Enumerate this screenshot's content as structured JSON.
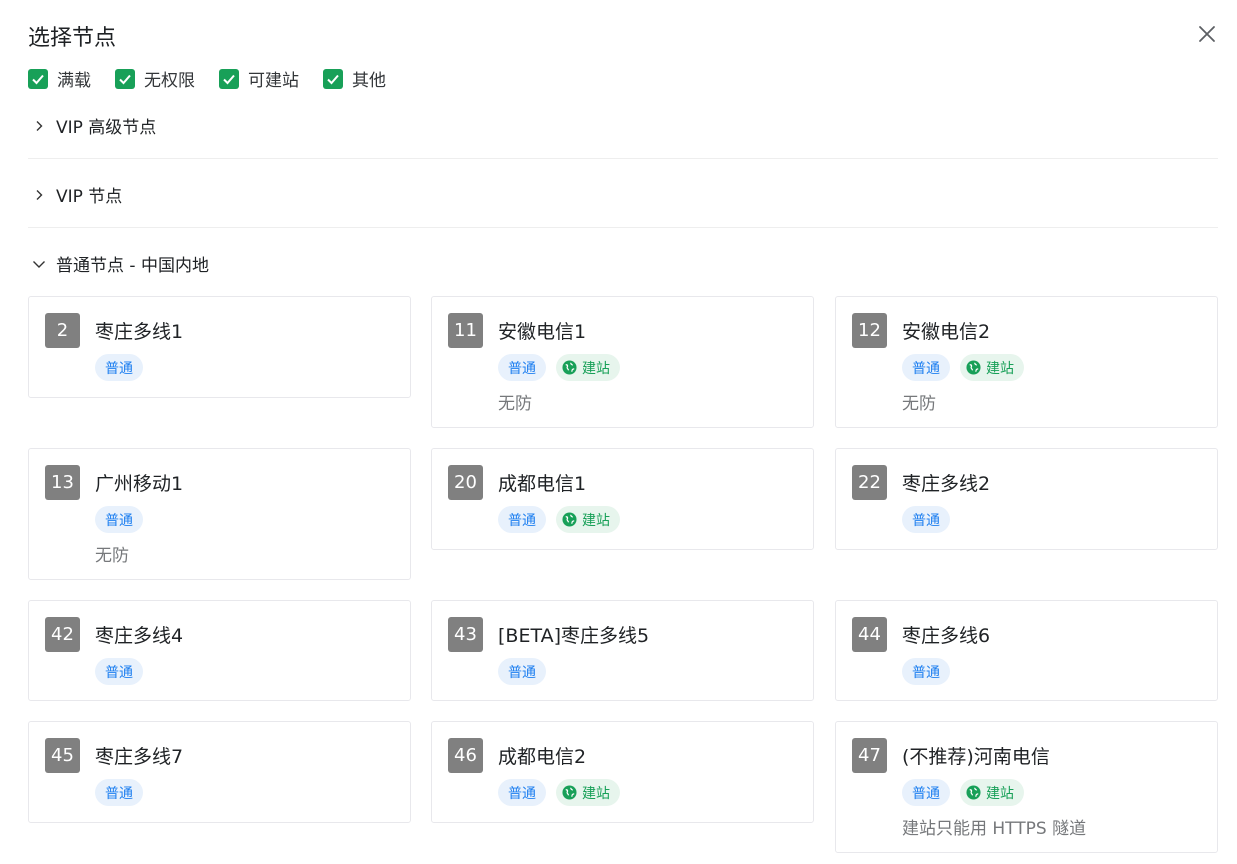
{
  "dialog": {
    "title": "选择节点",
    "close_icon": "close-icon"
  },
  "filters": [
    {
      "label": "满载",
      "checked": true
    },
    {
      "label": "无权限",
      "checked": true
    },
    {
      "label": "可建站",
      "checked": true
    },
    {
      "label": "其他",
      "checked": true
    }
  ],
  "groups": [
    {
      "label": "VIP 高级节点",
      "expanded": false
    },
    {
      "label": "VIP 节点",
      "expanded": false
    },
    {
      "label": "普通节点 - 中国内地",
      "expanded": true
    }
  ],
  "tag_labels": {
    "normal": "普通",
    "site": "建站"
  },
  "colors": {
    "accent_green": "#18a058",
    "tag_blue": "#2080f0",
    "badge_gray": "#808080"
  },
  "nodes": [
    {
      "id": "2",
      "name": "枣庄多线1",
      "tags": [
        "普通"
      ],
      "site": false,
      "note": ""
    },
    {
      "id": "11",
      "name": "安徽电信1",
      "tags": [
        "普通"
      ],
      "site": true,
      "note": "无防"
    },
    {
      "id": "12",
      "name": "安徽电信2",
      "tags": [
        "普通"
      ],
      "site": true,
      "note": "无防"
    },
    {
      "id": "13",
      "name": "广州移动1",
      "tags": [
        "普通"
      ],
      "site": false,
      "note": "无防"
    },
    {
      "id": "20",
      "name": "成都电信1",
      "tags": [
        "普通"
      ],
      "site": true,
      "note": ""
    },
    {
      "id": "22",
      "name": "枣庄多线2",
      "tags": [
        "普通"
      ],
      "site": false,
      "note": ""
    },
    {
      "id": "42",
      "name": "枣庄多线4",
      "tags": [
        "普通"
      ],
      "site": false,
      "note": ""
    },
    {
      "id": "43",
      "name": "[BETA]枣庄多线5",
      "tags": [
        "普通"
      ],
      "site": false,
      "note": ""
    },
    {
      "id": "44",
      "name": "枣庄多线6",
      "tags": [
        "普通"
      ],
      "site": false,
      "note": ""
    },
    {
      "id": "45",
      "name": "枣庄多线7",
      "tags": [
        "普通"
      ],
      "site": false,
      "note": ""
    },
    {
      "id": "46",
      "name": "成都电信2",
      "tags": [
        "普通"
      ],
      "site": true,
      "note": ""
    },
    {
      "id": "47",
      "name": "(不推荐)河南电信",
      "tags": [
        "普通"
      ],
      "site": true,
      "note": "建站只能用 HTTPS 隧道"
    }
  ]
}
